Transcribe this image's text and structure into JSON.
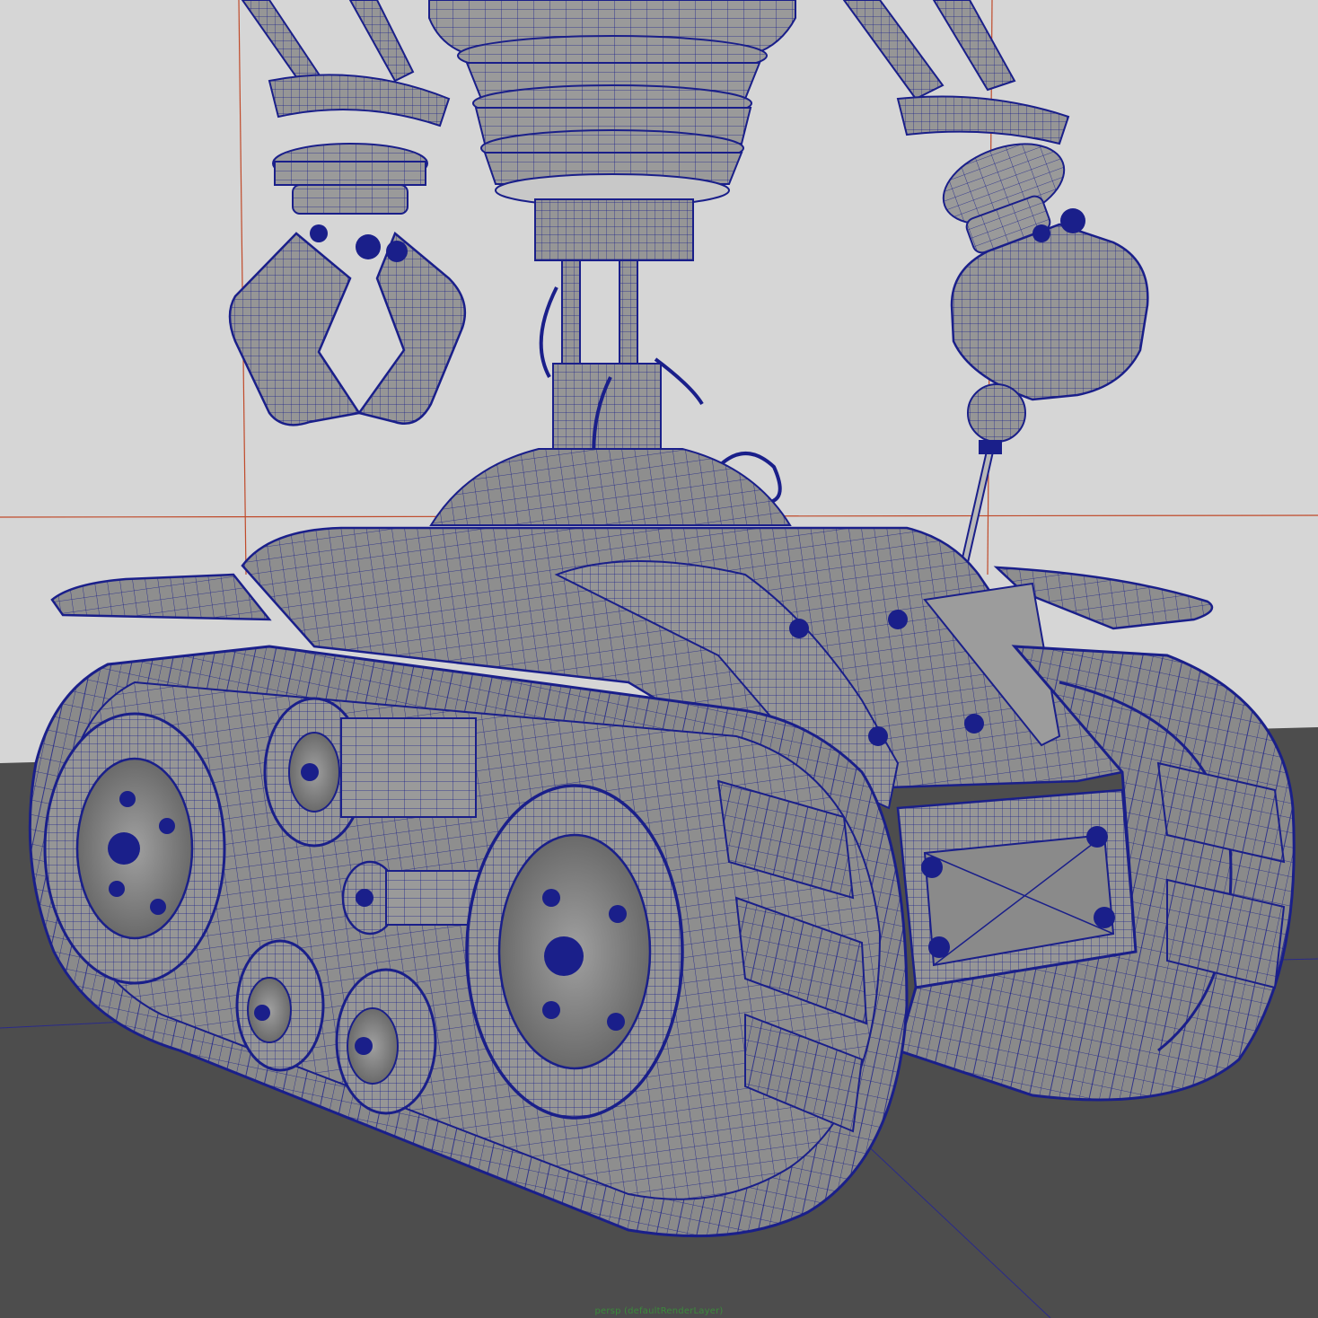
{
  "viewport": {
    "camera_label": "persp (defaultRenderLayer)",
    "display_mode": "wireframe-on-shaded",
    "subject_icon": "tracked-robot-icon"
  },
  "colors": {
    "background": "#d6d6d6",
    "floor": "#4d4d4d",
    "wireframe": "#1a1f8a",
    "surface": "#8c8c8c",
    "surface_light": "#a8a8a8",
    "surface_dark": "#6a6a6a",
    "grid_axis_red": "#c04a2a",
    "grid_axis_blue": "#2a2a8a",
    "label_green": "#3a8a3a"
  }
}
